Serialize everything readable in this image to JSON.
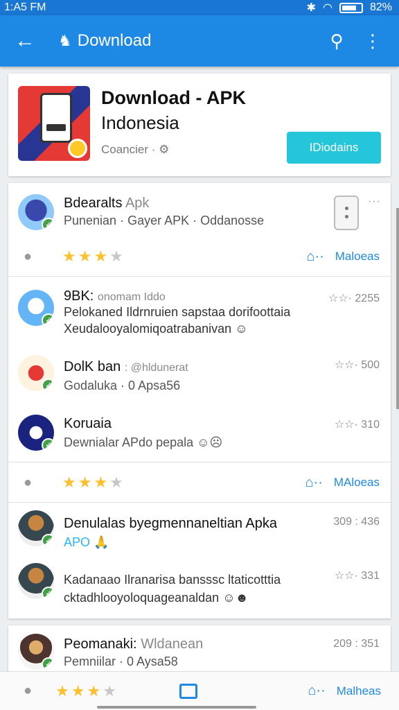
{
  "status": {
    "time": "1:A5 FM",
    "battery": "82%"
  },
  "appbar": {
    "title": "Download",
    "back_icon": "arrow-left-icon",
    "search_icon": "search-icon",
    "menu_icon": "more-vert-icon"
  },
  "hero": {
    "name": "Download - APK",
    "subtitle": "Indonesia",
    "meta": "Coancier ·",
    "button": "IDiodains"
  },
  "items": [
    {
      "title": "Bdearalts",
      "title_light": "Apk",
      "line2": "Punenian · Gayer APK · Oddanosse"
    },
    {
      "title": "9BK:",
      "title_light": "onomam Iddo",
      "line2": "Pelokaned Ildrnruien sapstaa dorifoottaia",
      "line3": "Xeudalooyalomiqoatrabanivan",
      "count": "2255"
    },
    {
      "title": "DolK ban",
      "title_light": ": @hldunerat",
      "line2": "Godaluka · 0 Apsa56",
      "count": "500"
    },
    {
      "title": "Koruaia",
      "line2": "Dewnialar APdo pepala",
      "count": "310"
    },
    {
      "title": "Denulalas byegmennaneltian Apka",
      "line2": "APO",
      "count": "309 : 436"
    },
    {
      "title": "Kadanaao Ilranarisa bansssc ltaticotttia",
      "line2": "cktadhlooyoloquageanaldan",
      "count": "331"
    },
    {
      "title": "Peomanaki:",
      "title_light": "Wldanean",
      "line2": "Pemniilar · 0 Aysa58",
      "count": "209 : 351"
    }
  ],
  "actions": {
    "more_label": "Maloeas",
    "more_label2": "MAloeas",
    "more_label3": "Malheas"
  },
  "colors": {
    "primary": "#1e88e5",
    "accent": "#26c6da",
    "star": "#fbc02d"
  }
}
